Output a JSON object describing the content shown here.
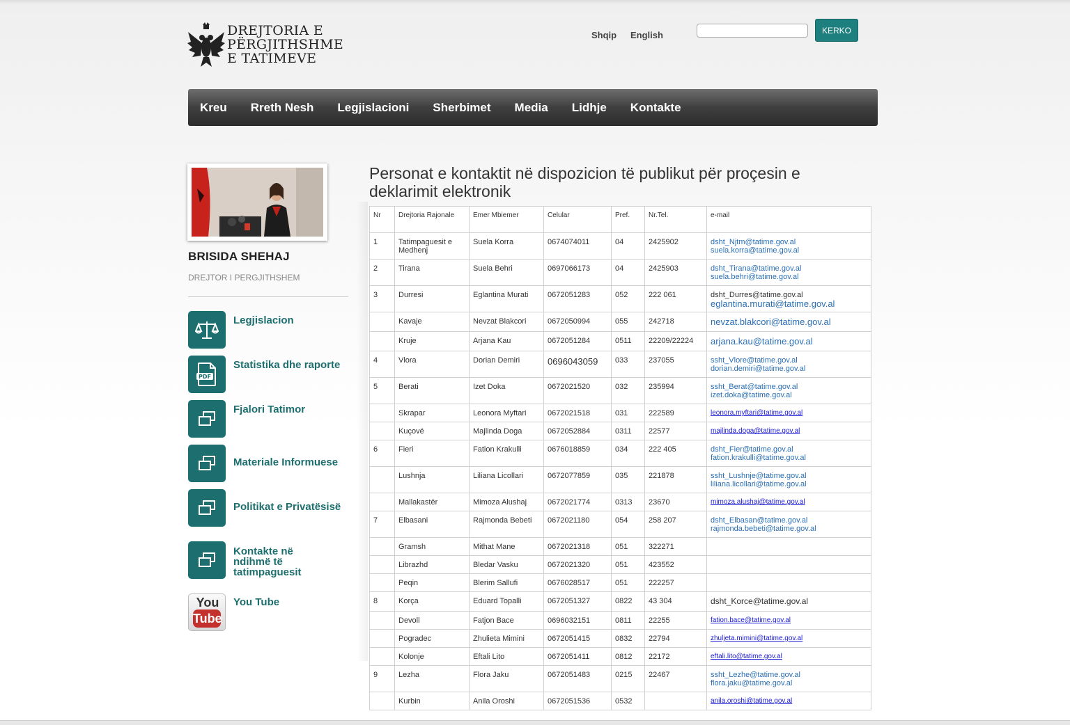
{
  "header": {
    "logo_lines": [
      "DREJTORIA E",
      "PËRGJITHSHME",
      "E TATIMEVE"
    ],
    "lang_sq": "Shqip",
    "lang_en": "English",
    "search_placeholder": "",
    "search_button": "KERKO",
    "accent_color": "#1d6e6e"
  },
  "nav": [
    "Kreu",
    "Rreth Nesh",
    "Legjislacioni",
    "Sherbimet",
    "Media",
    "Lidhje",
    "Kontakte"
  ],
  "sidebar": {
    "director_name": "BRISIDA SHEHAJ",
    "director_title": "DREJTOR I PERGJITHSHEM",
    "items": [
      {
        "label": "Legjislacion",
        "icon": "scales-icon"
      },
      {
        "label": "Statistika dhe raporte",
        "icon": "pdf-icon"
      },
      {
        "label": "Fjalori Tatimor",
        "icon": "windows-icon"
      },
      {
        "label": "Materiale Informuese",
        "icon": "windows-icon"
      },
      {
        "label": "Politikat e Privatësisë",
        "icon": "windows-icon"
      },
      {
        "label": "Kontakte në ndihmë të tatimpaguesit",
        "icon": "windows-icon"
      },
      {
        "label": "You Tube",
        "icon": "youtube-icon"
      }
    ],
    "youtube_you": "You",
    "youtube_tube": "Tube"
  },
  "main": {
    "title": "Personat e kontaktit në dispozicion të publikut për proçesin e deklarimit elektronik",
    "table": {
      "headers": [
        "Nr",
        "Drejtoria Rajonale",
        "Emer Mbiemer",
        "Celular",
        "Pref.",
        "Nr.Tel.",
        "e-mail"
      ],
      "rows": [
        {
          "nr": "1",
          "dr": "Tatimpaguesit e Medhenj",
          "name": "Suela Korra",
          "cel": "0674074011",
          "pref": "04",
          "tel": "2425902",
          "emails": [
            "dsht_Njtm@tatime.gov.al",
            "suela.korra@tatime.gov.al"
          ],
          "style": "blue"
        },
        {
          "nr": "2",
          "dr": "Tirana",
          "name": "Suela Behri",
          "cel": "0697066173",
          "pref": "04",
          "tel": "2425903",
          "emails": [
            "dsht_Tirana@tatime.gov.al",
            "suela.behri@tatime.gov.al"
          ],
          "style": "blue"
        },
        {
          "nr": "3",
          "dr": "Durresi",
          "name": "Eglantina Murati",
          "cel": "0672051283",
          "pref": "052",
          "tel": "222 061",
          "emails": [
            "dsht_Durres@tatime.gov.al",
            "eglantina.murati@tatime.gov.al"
          ],
          "style": "mixed"
        },
        {
          "nr": "",
          "dr": "Kavaje",
          "name": "Nevzat Blakcori",
          "cel": "0672050994",
          "pref": "055",
          "tel": "242718",
          "emails": [
            "nevzat.blakcori@tatime.gov.al"
          ],
          "style": "big"
        },
        {
          "nr": "",
          "dr": "Kruje",
          "name": "Arjana Kau",
          "cel": "0672051284",
          "pref": "0511",
          "tel": "22209/22224",
          "emails": [
            "arjana.kau@tatime.gov.al"
          ],
          "style": "big"
        },
        {
          "nr": "4",
          "dr": "Vlora",
          "name": "Dorian Demiri",
          "cel": "0696043059",
          "pref": "033",
          "tel": "237055",
          "emails": [
            "ssht_Vlore@tatime.gov.al",
            "dorian.demiri@tatime.gov.al"
          ],
          "style": "blue",
          "celbig": true
        },
        {
          "nr": "5",
          "dr": "Berati",
          "name": "Izet Doka",
          "cel": "0672021520",
          "pref": "032",
          "tel": "235994",
          "emails": [
            "ssht_Berat@tatime.gov.al",
            "izet.doka@tatime.gov.al"
          ],
          "style": "blue"
        },
        {
          "nr": "",
          "dr": "Skrapar",
          "name": "Leonora Myftari",
          "cel": "0672021518",
          "pref": "031",
          "tel": "222589",
          "emails": [
            "leonora.myftari@tatime.gov.al"
          ],
          "style": "ul"
        },
        {
          "nr": "",
          "dr": "Kuçovë",
          "name": "Majlinda Doga",
          "cel": "0672052884",
          "pref": "0311",
          "tel": "22577",
          "emails": [
            "majlinda.doga@tatime.gov.al"
          ],
          "style": "ul"
        },
        {
          "nr": "6",
          "dr": "Fieri",
          "name": "Fation Krakulli",
          "cel": "0676018859",
          "pref": "034",
          "tel": "222 405",
          "emails": [
            "dsht_Fier@tatime.gov.al",
            "fation.krakulli@tatime.gov.al"
          ],
          "style": "blue"
        },
        {
          "nr": "",
          "dr": "Lushnja",
          "name": "Liliana Licollari",
          "cel": "0672077859",
          "pref": "035",
          "tel": "221878",
          "emails": [
            "ssht_Lushnje@tatime.gov.al",
            "liliana.licollari@tatime.gov.al"
          ],
          "style": "blue"
        },
        {
          "nr": "",
          "dr": "Mallakastër",
          "name": "Mimoza Alushaj",
          "cel": "0672021774",
          "pref": "0313",
          "tel": "23670",
          "emails": [
            "mimoza.alushaj@tatime.gov.al"
          ],
          "style": "ul"
        },
        {
          "nr": "7",
          "dr": "Elbasani",
          "name": "Rajmonda Bebeti",
          "cel": "0672021180",
          "pref": "054",
          "tel": "258 207",
          "emails": [
            "dsht_Elbasan@tatime.gov.al",
            "rajmonda.bebeti@tatime.gov.al"
          ],
          "style": "blue"
        },
        {
          "nr": "",
          "dr": "Gramsh",
          "name": "Mithat Mane",
          "cel": "0672021318",
          "pref": "051",
          "tel": "322271",
          "emails": [],
          "style": "blue"
        },
        {
          "nr": "",
          "dr": "Librazhd",
          "name": "Bledar Vasku",
          "cel": "0672021320",
          "pref": "051",
          "tel": "423552",
          "emails": [],
          "style": "blue"
        },
        {
          "nr": "",
          "dr": "Peqin",
          "name": "Blerim Sallufi",
          "cel": "0676028517",
          "pref": "051",
          "tel": "222257",
          "emails": [],
          "style": "blue"
        },
        {
          "nr": "8",
          "dr": "Korça",
          "name": "Eduard Topalli",
          "cel": "0672051327",
          "pref": "0822",
          "tel": "43 304",
          "emails": [
            "dsht_Korce@tatime.gov.al"
          ],
          "style": "plainbig"
        },
        {
          "nr": "",
          "dr": "Devoll",
          "name": "Fatjon Bace",
          "cel": "0696032151",
          "pref": "0811",
          "tel": "22255",
          "emails": [
            "fation.bace@tatime.gov.al"
          ],
          "style": "ul"
        },
        {
          "nr": "",
          "dr": "Pogradec",
          "name": "Zhulieta Mimini",
          "cel": "0672051415",
          "pref": "0832",
          "tel": "22794",
          "emails": [
            "zhuljeta.mimini@tatime.gov.al"
          ],
          "style": "ul"
        },
        {
          "nr": "",
          "dr": "Kolonje",
          "name": "Eftali Lito",
          "cel": "0672051411",
          "pref": "0812",
          "tel": "22172",
          "emails": [
            "eftali.lito@tatime.gov.al"
          ],
          "style": "ul"
        },
        {
          "nr": "9",
          "dr": "Lezha",
          "name": "Flora Jaku",
          "cel": "0672051483",
          "pref": "0215",
          "tel": "22467",
          "emails": [
            "ssht_Lezhe@tatime.gov.al",
            "flora.jaku@tatime.gov.al"
          ],
          "style": "blue"
        },
        {
          "nr": "",
          "dr": "Kurbin",
          "name": "Anila Oroshi",
          "cel": "0672051536",
          "pref": "0532",
          "tel": "",
          "emails": [
            "anila.oroshi@tatime.gov.al"
          ],
          "style": "ul"
        }
      ]
    }
  }
}
